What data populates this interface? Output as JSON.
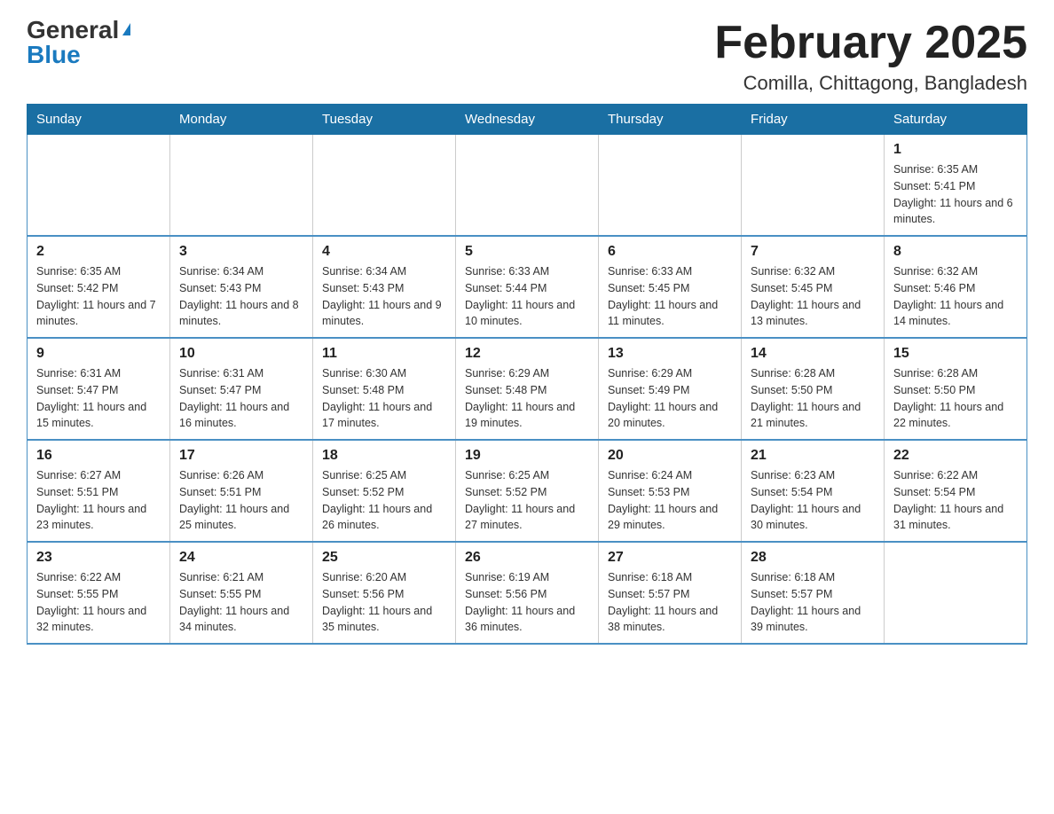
{
  "logo": {
    "general": "General",
    "blue": "Blue"
  },
  "title": "February 2025",
  "location": "Comilla, Chittagong, Bangladesh",
  "days_of_week": [
    "Sunday",
    "Monday",
    "Tuesday",
    "Wednesday",
    "Thursday",
    "Friday",
    "Saturday"
  ],
  "weeks": [
    [
      {
        "day": "",
        "info": ""
      },
      {
        "day": "",
        "info": ""
      },
      {
        "day": "",
        "info": ""
      },
      {
        "day": "",
        "info": ""
      },
      {
        "day": "",
        "info": ""
      },
      {
        "day": "",
        "info": ""
      },
      {
        "day": "1",
        "info": "Sunrise: 6:35 AM\nSunset: 5:41 PM\nDaylight: 11 hours and 6 minutes."
      }
    ],
    [
      {
        "day": "2",
        "info": "Sunrise: 6:35 AM\nSunset: 5:42 PM\nDaylight: 11 hours and 7 minutes."
      },
      {
        "day": "3",
        "info": "Sunrise: 6:34 AM\nSunset: 5:43 PM\nDaylight: 11 hours and 8 minutes."
      },
      {
        "day": "4",
        "info": "Sunrise: 6:34 AM\nSunset: 5:43 PM\nDaylight: 11 hours and 9 minutes."
      },
      {
        "day": "5",
        "info": "Sunrise: 6:33 AM\nSunset: 5:44 PM\nDaylight: 11 hours and 10 minutes."
      },
      {
        "day": "6",
        "info": "Sunrise: 6:33 AM\nSunset: 5:45 PM\nDaylight: 11 hours and 11 minutes."
      },
      {
        "day": "7",
        "info": "Sunrise: 6:32 AM\nSunset: 5:45 PM\nDaylight: 11 hours and 13 minutes."
      },
      {
        "day": "8",
        "info": "Sunrise: 6:32 AM\nSunset: 5:46 PM\nDaylight: 11 hours and 14 minutes."
      }
    ],
    [
      {
        "day": "9",
        "info": "Sunrise: 6:31 AM\nSunset: 5:47 PM\nDaylight: 11 hours and 15 minutes."
      },
      {
        "day": "10",
        "info": "Sunrise: 6:31 AM\nSunset: 5:47 PM\nDaylight: 11 hours and 16 minutes."
      },
      {
        "day": "11",
        "info": "Sunrise: 6:30 AM\nSunset: 5:48 PM\nDaylight: 11 hours and 17 minutes."
      },
      {
        "day": "12",
        "info": "Sunrise: 6:29 AM\nSunset: 5:48 PM\nDaylight: 11 hours and 19 minutes."
      },
      {
        "day": "13",
        "info": "Sunrise: 6:29 AM\nSunset: 5:49 PM\nDaylight: 11 hours and 20 minutes."
      },
      {
        "day": "14",
        "info": "Sunrise: 6:28 AM\nSunset: 5:50 PM\nDaylight: 11 hours and 21 minutes."
      },
      {
        "day": "15",
        "info": "Sunrise: 6:28 AM\nSunset: 5:50 PM\nDaylight: 11 hours and 22 minutes."
      }
    ],
    [
      {
        "day": "16",
        "info": "Sunrise: 6:27 AM\nSunset: 5:51 PM\nDaylight: 11 hours and 23 minutes."
      },
      {
        "day": "17",
        "info": "Sunrise: 6:26 AM\nSunset: 5:51 PM\nDaylight: 11 hours and 25 minutes."
      },
      {
        "day": "18",
        "info": "Sunrise: 6:25 AM\nSunset: 5:52 PM\nDaylight: 11 hours and 26 minutes."
      },
      {
        "day": "19",
        "info": "Sunrise: 6:25 AM\nSunset: 5:52 PM\nDaylight: 11 hours and 27 minutes."
      },
      {
        "day": "20",
        "info": "Sunrise: 6:24 AM\nSunset: 5:53 PM\nDaylight: 11 hours and 29 minutes."
      },
      {
        "day": "21",
        "info": "Sunrise: 6:23 AM\nSunset: 5:54 PM\nDaylight: 11 hours and 30 minutes."
      },
      {
        "day": "22",
        "info": "Sunrise: 6:22 AM\nSunset: 5:54 PM\nDaylight: 11 hours and 31 minutes."
      }
    ],
    [
      {
        "day": "23",
        "info": "Sunrise: 6:22 AM\nSunset: 5:55 PM\nDaylight: 11 hours and 32 minutes."
      },
      {
        "day": "24",
        "info": "Sunrise: 6:21 AM\nSunset: 5:55 PM\nDaylight: 11 hours and 34 minutes."
      },
      {
        "day": "25",
        "info": "Sunrise: 6:20 AM\nSunset: 5:56 PM\nDaylight: 11 hours and 35 minutes."
      },
      {
        "day": "26",
        "info": "Sunrise: 6:19 AM\nSunset: 5:56 PM\nDaylight: 11 hours and 36 minutes."
      },
      {
        "day": "27",
        "info": "Sunrise: 6:18 AM\nSunset: 5:57 PM\nDaylight: 11 hours and 38 minutes."
      },
      {
        "day": "28",
        "info": "Sunrise: 6:18 AM\nSunset: 5:57 PM\nDaylight: 11 hours and 39 minutes."
      },
      {
        "day": "",
        "info": ""
      }
    ]
  ],
  "colors": {
    "header_bg": "#1a6fa3",
    "header_text": "#ffffff",
    "border": "#4a90c4"
  }
}
